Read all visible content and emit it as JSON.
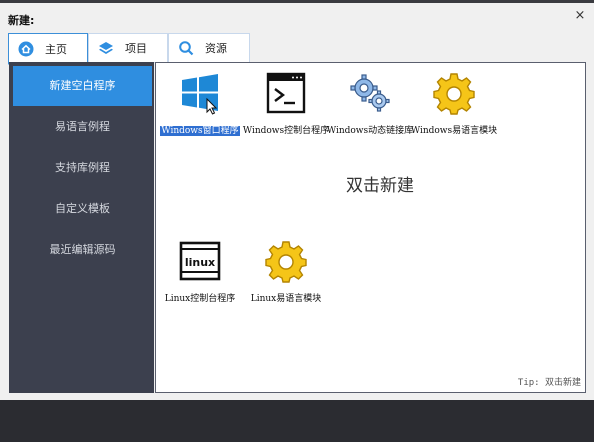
{
  "dialog": {
    "title": "新建:",
    "close_symbol": "×"
  },
  "tabs": [
    {
      "label": "主页",
      "icon": "home-icon",
      "active": true
    },
    {
      "label": "项目",
      "icon": "layers-icon",
      "active": false
    },
    {
      "label": "资源",
      "icon": "search-icon",
      "active": false
    }
  ],
  "sidebar": {
    "items": [
      {
        "label": "新建空白程序",
        "active": true
      },
      {
        "label": "易语言例程",
        "active": false
      },
      {
        "label": "支持库例程",
        "active": false
      },
      {
        "label": "自定义模板",
        "active": false
      },
      {
        "label": "最近编辑源码",
        "active": false
      }
    ]
  },
  "templates": [
    {
      "label": "Windows窗口程序",
      "icon": "windows-logo-icon",
      "selected": true
    },
    {
      "label": "Windows控制台程序",
      "icon": "console-icon",
      "selected": false
    },
    {
      "label": "Windows动态链接库",
      "icon": "gears-icon",
      "selected": false
    },
    {
      "label": "Windows易语言模块",
      "icon": "gear-icon",
      "selected": false
    },
    {
      "label": "Linux控制台程序",
      "icon": "linux-console-icon",
      "selected": false
    },
    {
      "label": "Linux易语言模块",
      "icon": "gear-icon",
      "selected": false
    }
  ],
  "main": {
    "hint": "双击新建",
    "tip": "Tip: 双击新建"
  },
  "colors": {
    "accent": "#2f8ee0",
    "sidebar_bg": "#3c404e",
    "gear": "#f5c518"
  }
}
